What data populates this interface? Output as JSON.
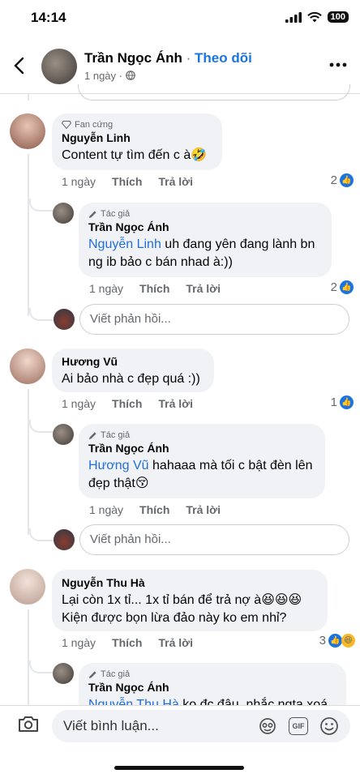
{
  "status": {
    "time": "14:14",
    "battery": "100"
  },
  "header": {
    "name": "Trần Ngọc Ánh",
    "separator": " · ",
    "follow": "Theo dõi",
    "time": "1 ngày",
    "dot": " · "
  },
  "comments": [
    {
      "badge": "Fan cứng",
      "name": "Nguyễn Linh",
      "text": "Content tự tìm đến c à🤣",
      "time": "1 ngày",
      "like": "Thích",
      "reply": "Trả lời",
      "count": "2",
      "reply_item": {
        "badge": "Tác giả",
        "name": "Trần Ngọc Ánh",
        "mention": "Nguyễn Linh",
        "text": " uh đang yên đang lành bn ng ib bảo c bán nhad à:))",
        "time": "1 ngày",
        "like": "Thích",
        "reply": "Trả lời",
        "count": "2"
      },
      "reply_placeholder": "Viết phản hồi..."
    },
    {
      "name": "Hương Vũ",
      "text": "Ai bảo nhà c đẹp quá :))",
      "time": "1 ngày",
      "like": "Thích",
      "reply": "Trả lời",
      "count": "1",
      "reply_item": {
        "badge": "Tác giả",
        "name": "Trần Ngọc Ánh",
        "mention": "Hương Vũ",
        "text": " hahaaa mà tối c bật đèn lên đẹp thật😚",
        "time": "1 ngày",
        "like": "Thích",
        "reply": "Trả lời"
      },
      "reply_placeholder": "Viết phản hồi..."
    },
    {
      "name": "Nguyễn Thu Hà",
      "text": "Lại còn 1x tỉ... 1x tỉ bán để trả nợ à😆😆😆 Kiện được bọn lừa đảo này ko em nhỉ?",
      "time": "1 ngày",
      "like": "Thích",
      "reply": "Trả lời",
      "count": "3",
      "reply_item": {
        "badge": "Tác giả",
        "name": "Trần Ngọc Ánh",
        "mention": "Nguyễn Thu Hà",
        "text": " ko đc đâu, nhắc ngta xoá"
      }
    }
  ],
  "composer": {
    "placeholder": "Viết bình luận...",
    "gif": "GIF"
  },
  "colors": {
    "accent": "#1b74e4",
    "bubble": "#f0f2f5",
    "muted": "#65676b"
  }
}
